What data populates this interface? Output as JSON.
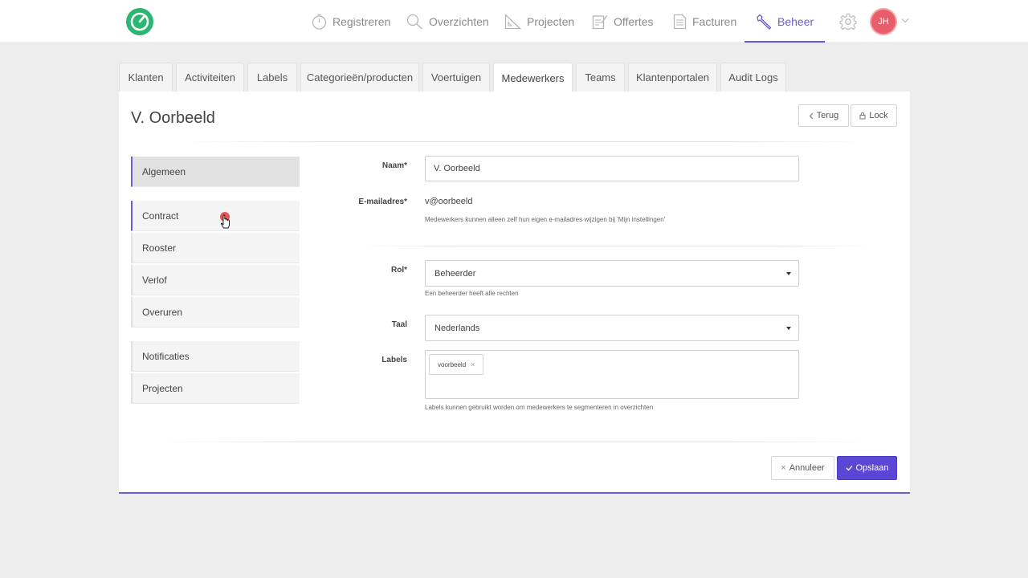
{
  "nav": {
    "items": [
      {
        "label": "Registreren",
        "icon": "stopwatch-icon"
      },
      {
        "label": "Overzichten",
        "icon": "search-icon"
      },
      {
        "label": "Projecten",
        "icon": "ruler-triangle-icon"
      },
      {
        "label": "Offertes",
        "icon": "edit-document-icon"
      },
      {
        "label": "Facturen",
        "icon": "invoice-icon"
      },
      {
        "label": "Beheer",
        "icon": "wrench-icon",
        "active": true
      }
    ],
    "avatar_initials": "JH"
  },
  "tabs": [
    {
      "label": "Klanten"
    },
    {
      "label": "Activiteiten"
    },
    {
      "label": "Labels"
    },
    {
      "label": "Categorieën/producten"
    },
    {
      "label": "Voertuigen"
    },
    {
      "label": "Medewerkers",
      "active": true
    },
    {
      "label": "Teams"
    },
    {
      "label": "Klantenportalen"
    },
    {
      "label": "Audit Logs"
    }
  ],
  "page": {
    "title": "V. Oorbeeld",
    "back_label": "Terug",
    "lock_label": "Lock"
  },
  "side_menu": {
    "groups": [
      [
        "Algemeen"
      ],
      [
        "Contract",
        "Rooster",
        "Verlof",
        "Overuren"
      ],
      [
        "Notificaties",
        "Projecten"
      ]
    ]
  },
  "form": {
    "name_label": "Naam*",
    "name_value": "V. Oorbeeld",
    "email_label": "E-mailadres*",
    "email_value": "v@oorbeeld",
    "email_help": "Medewerkers kunnen alleen zelf hun eigen e-mailadres wijzigen bij 'Mijn instellingen'",
    "role_label": "Rol*",
    "role_value": "Beheerder",
    "role_help": "Een beheerder heeft alle rechten",
    "language_label": "Taal",
    "language_value": "Nederlands",
    "labels_label": "Labels",
    "labels_chip": "voorbeeld",
    "labels_help": "Labels kunnen gebruikt worden om medewerkers te segmenteren in overzichten"
  },
  "footer": {
    "cancel_label": "Annuleer",
    "save_label": "Opslaan"
  },
  "colors": {
    "accent": "#6c5dd3",
    "brand_green": "#2bb673",
    "avatar": "#e85d6a"
  }
}
